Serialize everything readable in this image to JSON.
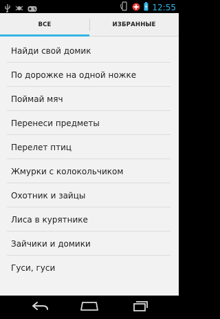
{
  "status_bar": {
    "time": "12:55",
    "colors": {
      "icon": "#33b5e5",
      "alert": "#e53935"
    },
    "left_icons": [
      "usb-icon",
      "debug-icon",
      "gamepad-icon"
    ],
    "right_icons": [
      "rotate-icon",
      "medical-alert-icon",
      "battery-icon"
    ]
  },
  "tabs": [
    {
      "label": "ВСЕ",
      "active": true
    },
    {
      "label": "ИЗБРАННЫЕ",
      "active": false
    }
  ],
  "accent_color": "#33b5e5",
  "games": [
    "Найди свой домик",
    "По дорожке на одной ножке",
    "Поймай мяч",
    "Перенеси предметы",
    "Перелет птиц",
    "Жмурки с колокольчиком",
    "Охотник и зайцы",
    "Лиса в курятнике",
    "Зайчики и домики",
    "Гуси, гуси"
  ],
  "nav_bar": {
    "buttons": [
      "back-icon",
      "home-icon",
      "recent-apps-icon"
    ]
  }
}
